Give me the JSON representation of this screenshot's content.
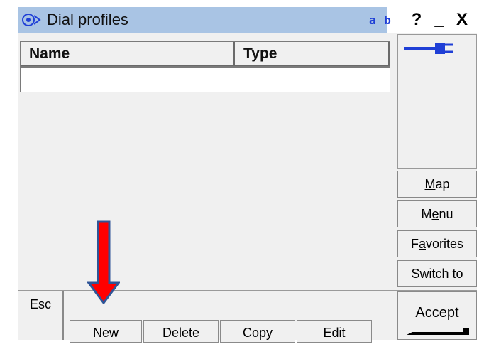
{
  "window": {
    "title": "Dial profiles",
    "ab_label": "a b",
    "help_label": "?",
    "minimize_label": "_",
    "close_label": "X"
  },
  "list": {
    "columns": [
      "Name",
      "Type"
    ],
    "rows": []
  },
  "side_buttons": [
    {
      "pre": "",
      "u": "M",
      "post": "ap",
      "name": "map-button"
    },
    {
      "pre": "M",
      "u": "e",
      "post": "nu",
      "name": "menu-button"
    },
    {
      "pre": "F",
      "u": "a",
      "post": "vorites",
      "name": "favorites-button"
    },
    {
      "pre": "S",
      "u": "w",
      "post": "itch to",
      "name": "switch-to-button"
    }
  ],
  "bottom": {
    "esc_label": "Esc",
    "new_label": "New",
    "delete_label": "Delete",
    "copy_label": "Copy",
    "edit_label": "Edit",
    "accept_label": "Accept"
  },
  "colors": {
    "title_bar": "#a9c4e4",
    "ab_text": "#1f3fd6",
    "plug_icon": "#1f3fd6",
    "arrow_fill": "#ff0000",
    "arrow_outline": "#2f5597"
  },
  "icons": [
    "app-icon",
    "plug-icon",
    "red-down-arrow"
  ]
}
